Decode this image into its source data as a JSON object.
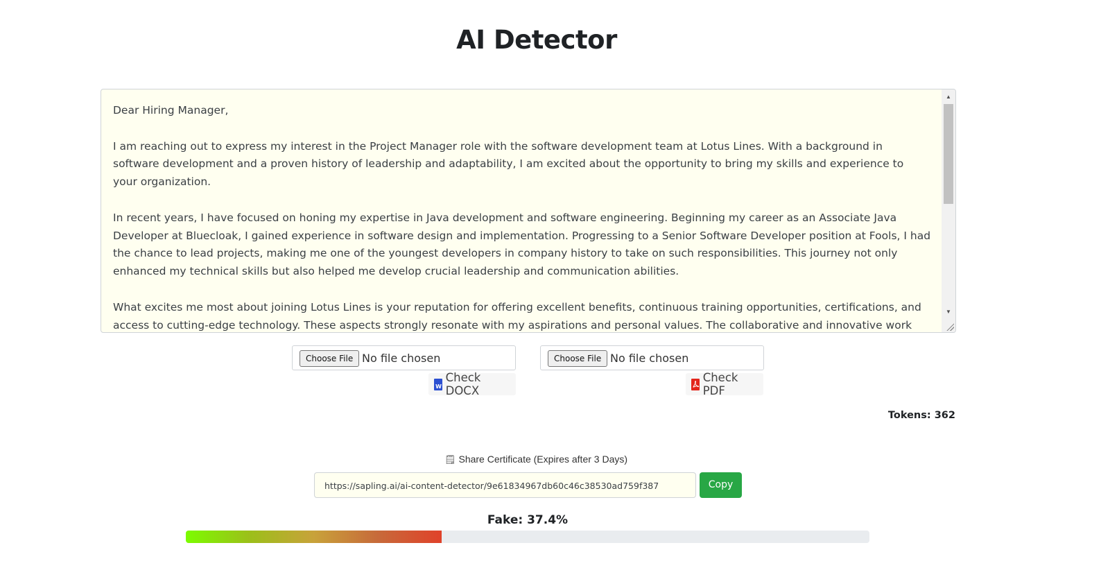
{
  "page": {
    "title": "AI Detector"
  },
  "editor": {
    "paragraphs": [
      "Dear Hiring Manager,",
      "I am reaching out to express my interest in the Project Manager role with the software development team at Lotus Lines. With a background in software development and a proven history of leadership and adaptability, I am excited about the opportunity to bring my skills and experience to your organization.",
      "In recent years, I have focused on honing my expertise in Java development and software engineering. Beginning my career as an Associate Java Developer at Bluecloak, I gained experience in software design and implementation. Progressing to a Senior Software Developer position at Fools, I had the chance to lead projects, making me one of the youngest developers in company history to take on such responsibilities. This journey not only enhanced my technical skills but also helped me develop crucial leadership and communication abilities.",
      "What excites me most about joining Lotus Lines is your reputation for offering excellent benefits, continuous training opportunities, certifications, and access to cutting-edge technology. These aspects strongly resonate with my aspirations and personal values. The collaborative and innovative work"
    ]
  },
  "uploads": {
    "docx": {
      "choose_label": "Choose File",
      "status": "No file chosen",
      "check_label": "Check DOCX",
      "icon": "word-doc-icon",
      "icon_glyph": "W",
      "color": "#2b4fd1"
    },
    "pdf": {
      "choose_label": "Choose File",
      "status": "No file chosen",
      "check_label": "Check PDF",
      "icon": "pdf-doc-icon",
      "color": "#e3261c"
    }
  },
  "tokens": {
    "label": "Tokens: 362"
  },
  "share": {
    "label": "Share Certificate (Expires after 3 Days)",
    "icon": "certificate-icon",
    "url": "https://sapling.ai/ai-content-detector/9e61834967db60c46c38530ad759f387",
    "copy_label": "Copy"
  },
  "result": {
    "label": "Fake: 37.4%",
    "fake_percent": 37.4,
    "colors": {
      "start": "#7cfc00",
      "end": "#e0422a",
      "track": "#e9ecef"
    }
  }
}
